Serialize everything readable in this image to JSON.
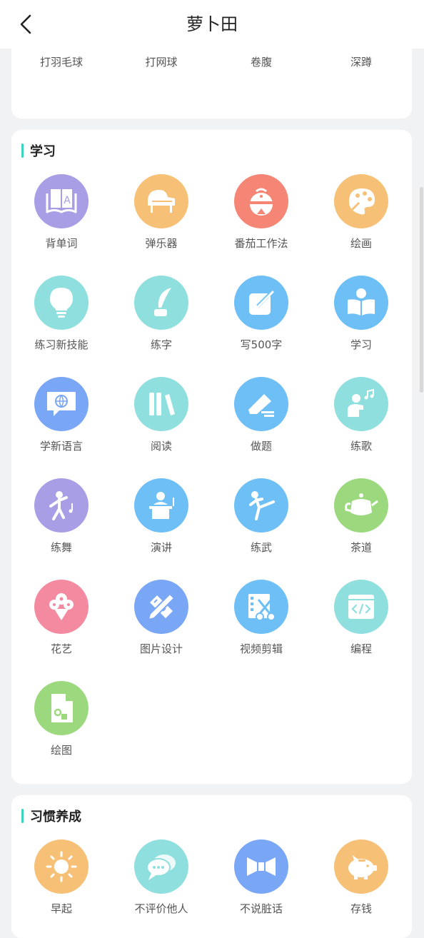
{
  "header": {
    "title": "萝卜田"
  },
  "sports": {
    "items": [
      {
        "label": "打羽毛球",
        "icon": "badminton-icon",
        "color": "#9cd97e"
      },
      {
        "label": "打网球",
        "icon": "tennis-icon",
        "color": "#6dbff6"
      },
      {
        "label": "卷腹",
        "icon": "crunch-icon",
        "color": "#f6c176"
      },
      {
        "label": "深蹲",
        "icon": "squat-icon",
        "color": "#f6c176"
      }
    ]
  },
  "study": {
    "title": "学习",
    "items": [
      {
        "label": "背单词",
        "icon": "vocabulary-book-icon",
        "color": "#a79ee6"
      },
      {
        "label": "弹乐器",
        "icon": "piano-icon",
        "color": "#f6c176"
      },
      {
        "label": "番茄工作法",
        "icon": "tomato-timer-icon",
        "color": "#f58675"
      },
      {
        "label": "绘画",
        "icon": "palette-icon",
        "color": "#f6c176"
      },
      {
        "label": "练习新技能",
        "icon": "lightbulb-icon",
        "color": "#8fdfde"
      },
      {
        "label": "练字",
        "icon": "quill-pen-icon",
        "color": "#8fdfde"
      },
      {
        "label": "写500字",
        "icon": "edit-note-icon",
        "color": "#6dbff6"
      },
      {
        "label": "学习",
        "icon": "reading-person-icon",
        "color": "#6dbff6"
      },
      {
        "label": "学新语言",
        "icon": "globe-chat-icon",
        "color": "#7aa6f6"
      },
      {
        "label": "阅读",
        "icon": "books-icon",
        "color": "#8fdfde"
      },
      {
        "label": "做题",
        "icon": "eraser-pencil-icon",
        "color": "#6dbff6"
      },
      {
        "label": "练歌",
        "icon": "singer-icon",
        "color": "#8fdfde"
      },
      {
        "label": "练舞",
        "icon": "dancer-icon",
        "color": "#a79ee6"
      },
      {
        "label": "演讲",
        "icon": "podium-icon",
        "color": "#6dbff6"
      },
      {
        "label": "练武",
        "icon": "martial-arts-icon",
        "color": "#6dbff6"
      },
      {
        "label": "茶道",
        "icon": "teapot-icon",
        "color": "#9cd97e"
      },
      {
        "label": "花艺",
        "icon": "flower-bouquet-icon",
        "color": "#f48aa0"
      },
      {
        "label": "图片设计",
        "icon": "ruler-pencil-icon",
        "color": "#7aa6f6"
      },
      {
        "label": "视频剪辑",
        "icon": "film-scissors-icon",
        "color": "#6dbff6"
      },
      {
        "label": "编程",
        "icon": "code-window-icon",
        "color": "#8fdfde"
      },
      {
        "label": "绘图",
        "icon": "drawing-file-icon",
        "color": "#9cd97e"
      }
    ]
  },
  "habit": {
    "title": "习惯养成",
    "items": [
      {
        "label": "早起",
        "icon": "sun-icon",
        "color": "#f6c176"
      },
      {
        "label": "不评价他人",
        "icon": "chat-bubbles-icon",
        "color": "#8fdfde"
      },
      {
        "label": "不说脏话",
        "icon": "bow-tie-icon",
        "color": "#7aa6f6"
      },
      {
        "label": "存钱",
        "icon": "piggy-bank-icon",
        "color": "#f6c176"
      }
    ]
  }
}
